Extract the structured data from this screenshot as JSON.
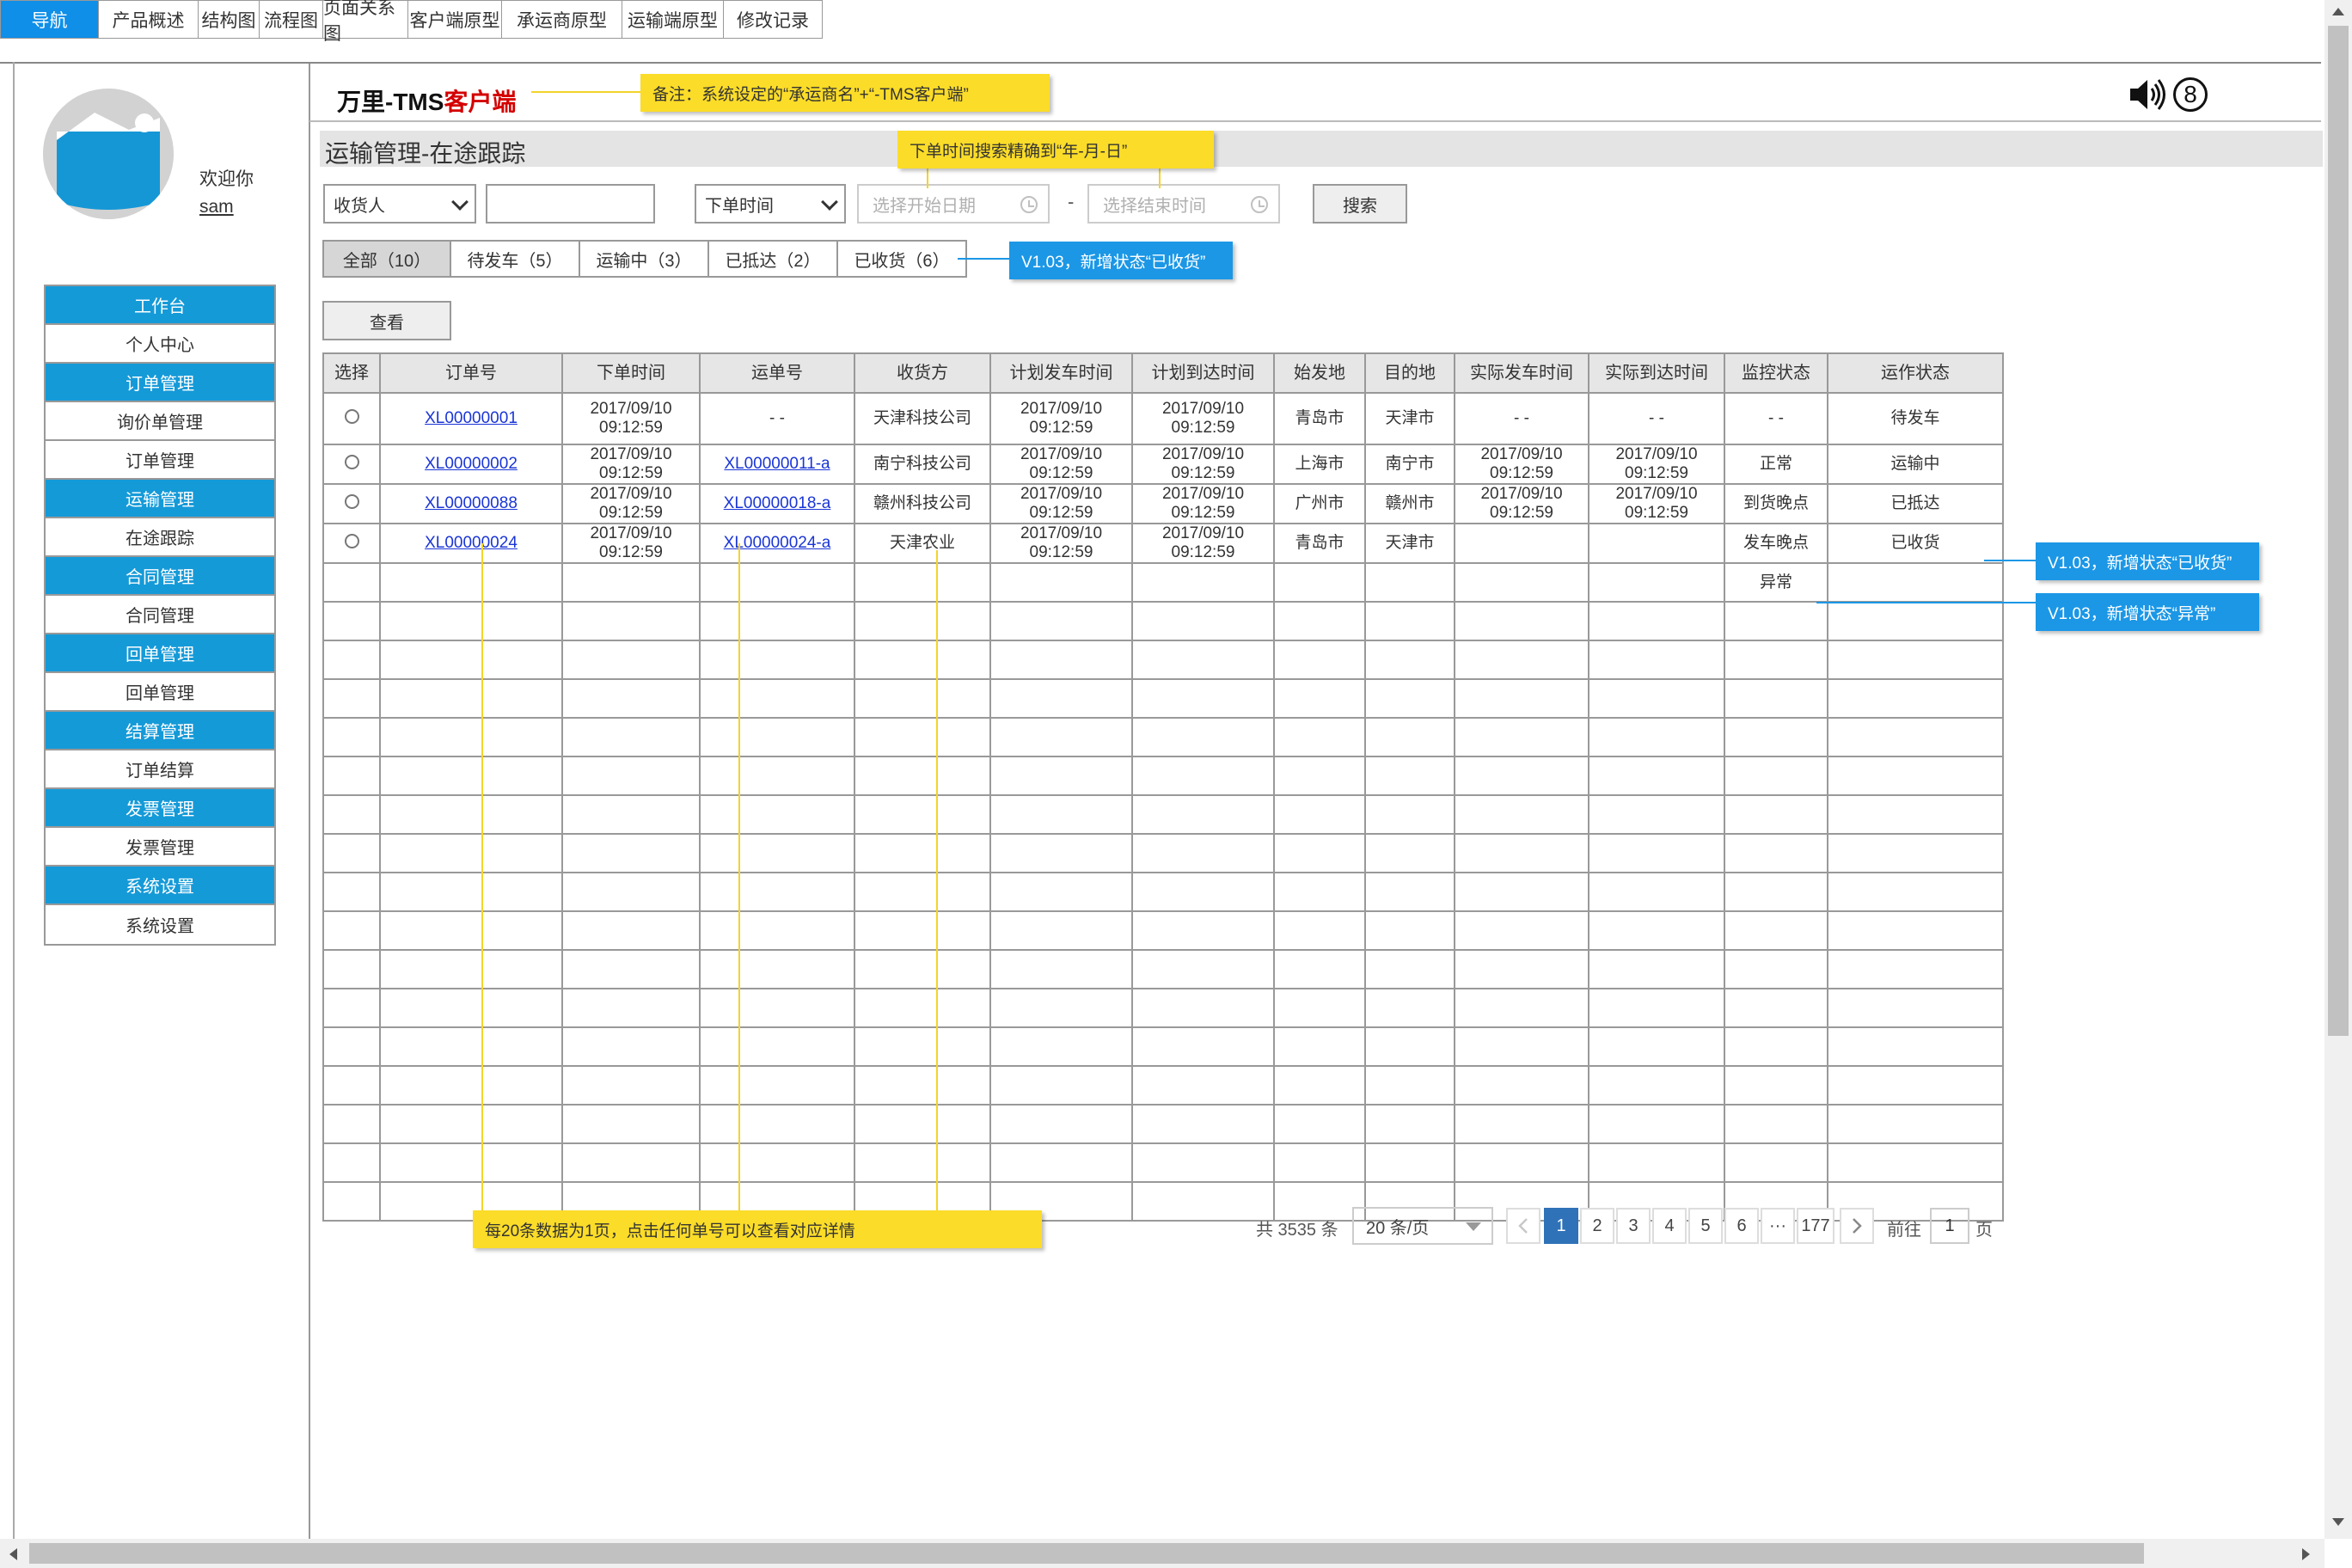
{
  "top_tabs": [
    "导航",
    "产品概述",
    "结构图",
    "流程图",
    "页面关系图",
    "客户端原型",
    "承运商原型",
    "运输端原型",
    "修改记录"
  ],
  "sidebar": {
    "welcome": "欢迎你",
    "username": "sam",
    "items": [
      {
        "label": "工作台",
        "group": true
      },
      {
        "label": "个人中心",
        "group": false
      },
      {
        "label": "订单管理",
        "group": true
      },
      {
        "label": "询价单管理",
        "group": false
      },
      {
        "label": "订单管理",
        "group": false
      },
      {
        "label": "运输管理",
        "group": true
      },
      {
        "label": "在途跟踪",
        "group": false
      },
      {
        "label": "合同管理",
        "group": true
      },
      {
        "label": "合同管理",
        "group": false
      },
      {
        "label": "回单管理",
        "group": true
      },
      {
        "label": "回单管理",
        "group": false
      },
      {
        "label": "结算管理",
        "group": true
      },
      {
        "label": "订单结算",
        "group": false
      },
      {
        "label": "发票管理",
        "group": true
      },
      {
        "label": "发票管理",
        "group": false
      },
      {
        "label": "系统设置",
        "group": true
      },
      {
        "label": "系统设置",
        "group": false
      }
    ]
  },
  "header": {
    "title_prefix": "万里-TMS",
    "title_suffix": "客户端",
    "message_count": "8"
  },
  "page": {
    "title": "运输管理-在途跟踪"
  },
  "search": {
    "field_select": "收货人",
    "field_value": "",
    "time_select": "下单时间",
    "start_placeholder": "选择开始日期",
    "end_placeholder": "选择结束时间",
    "separator": "-",
    "search_button": "搜索"
  },
  "status_tabs": [
    "全部（10）",
    "待发车（5）",
    "运输中（3）",
    "已抵达（2）",
    "已收货（6）"
  ],
  "view_button": "查看",
  "table": {
    "headers": [
      "选择",
      "订单号",
      "下单时间",
      "运单号",
      "收货方",
      "计划发车时间",
      "计划到达时间",
      "始发地",
      "目的地",
      "实际发车时间",
      "实际到达时间",
      "监控状态",
      "运作状态"
    ],
    "rows": [
      {
        "order": "XL00000001",
        "order_time": [
          "2017/09/10",
          "09:12:59"
        ],
        "waybill": "- -",
        "receiver": "天津科技公司",
        "plan_depart": [
          "2017/09/10",
          "09:12:59"
        ],
        "plan_arrive": [
          "2017/09/10",
          "09:12:59"
        ],
        "origin": "青岛市",
        "destination": "天津市",
        "actual_depart": "- -",
        "actual_arrive": "- -",
        "monitor": "- -",
        "monitor_alert": false,
        "status": "待发车"
      },
      {
        "order": "XL00000002",
        "order_time": [
          "2017/09/10",
          "09:12:59"
        ],
        "waybill": "XL00000011-a",
        "receiver": "南宁科技公司",
        "plan_depart": [
          "2017/09/10",
          "09:12:59"
        ],
        "plan_arrive": [
          "2017/09/10",
          "09:12:59"
        ],
        "origin": "上海市",
        "destination": "南宁市",
        "actual_depart": [
          "2017/09/10",
          "09:12:59"
        ],
        "actual_arrive": [
          "2017/09/10",
          "09:12:59"
        ],
        "monitor": "正常",
        "monitor_alert": false,
        "status": "运输中"
      },
      {
        "order": "XL00000088",
        "order_time": [
          "2017/09/10",
          "09:12:59"
        ],
        "waybill": "XL00000018-a",
        "receiver": "赣州科技公司",
        "plan_depart": [
          "2017/09/10",
          "09:12:59"
        ],
        "plan_arrive": [
          "2017/09/10",
          "09:12:59"
        ],
        "origin": "广州市",
        "destination": "赣州市",
        "actual_depart": [
          "2017/09/10",
          "09:12:59"
        ],
        "actual_arrive": [
          "2017/09/10",
          "09:12:59"
        ],
        "monitor": "到货晚点",
        "monitor_alert": true,
        "status": "已抵达"
      },
      {
        "order": "XL00000024",
        "order_time": [
          "2017/09/10",
          "09:12:59"
        ],
        "waybill": "XL00000024-a",
        "receiver": "天津农业",
        "plan_depart": [
          "2017/09/10",
          "09:12:59"
        ],
        "plan_arrive": [
          "2017/09/10",
          "09:12:59"
        ],
        "origin": "青岛市",
        "destination": "天津市",
        "actual_depart": "",
        "actual_arrive": "",
        "monitor": "发车晚点",
        "monitor_alert": true,
        "status": "已收货"
      },
      {
        "order": "",
        "order_time": "",
        "waybill": "",
        "receiver": "",
        "plan_depart": "",
        "plan_arrive": "",
        "origin": "",
        "destination": "",
        "actual_depart": "",
        "actual_arrive": "",
        "monitor": "异常",
        "monitor_alert": false,
        "status": ""
      }
    ],
    "empty_rows": 16
  },
  "pagination": {
    "total": "共 3535 条",
    "page_size": "20 条/页",
    "pages": [
      "1",
      "2",
      "3",
      "4",
      "5",
      "6",
      "···",
      "177"
    ],
    "current": "1",
    "goto_label": "前往",
    "goto_value": "1",
    "goto_suffix": "页"
  },
  "annotations": {
    "title_note": "备注：系统设定的“承运商名”+“-TMS客户端”",
    "time_note": "下单时间搜索精确到“年-月-日”",
    "tab_note": "V1.03，新增状态“已收货”",
    "status_note": "V1.03，新增状态“已收货”",
    "monitor_note": "V1.03，新增状态“异常”",
    "page_note": "每20条数据为1页，点击任何单号可以查看对应详情"
  },
  "colors": {
    "accent_blue": "#159ad8",
    "tab_active": "#0f8fe8",
    "note_yellow": "#fbdc28",
    "note_blue": "#1b97e6",
    "link": "#1a35d6",
    "alert_red": "#e53333",
    "brand_red": "#d40000",
    "page_active": "#2f72b8"
  },
  "icons": {
    "speaker": "speaker-icon",
    "avatar": "avatar-placeholder-icon",
    "calendar": "clock-icon"
  }
}
